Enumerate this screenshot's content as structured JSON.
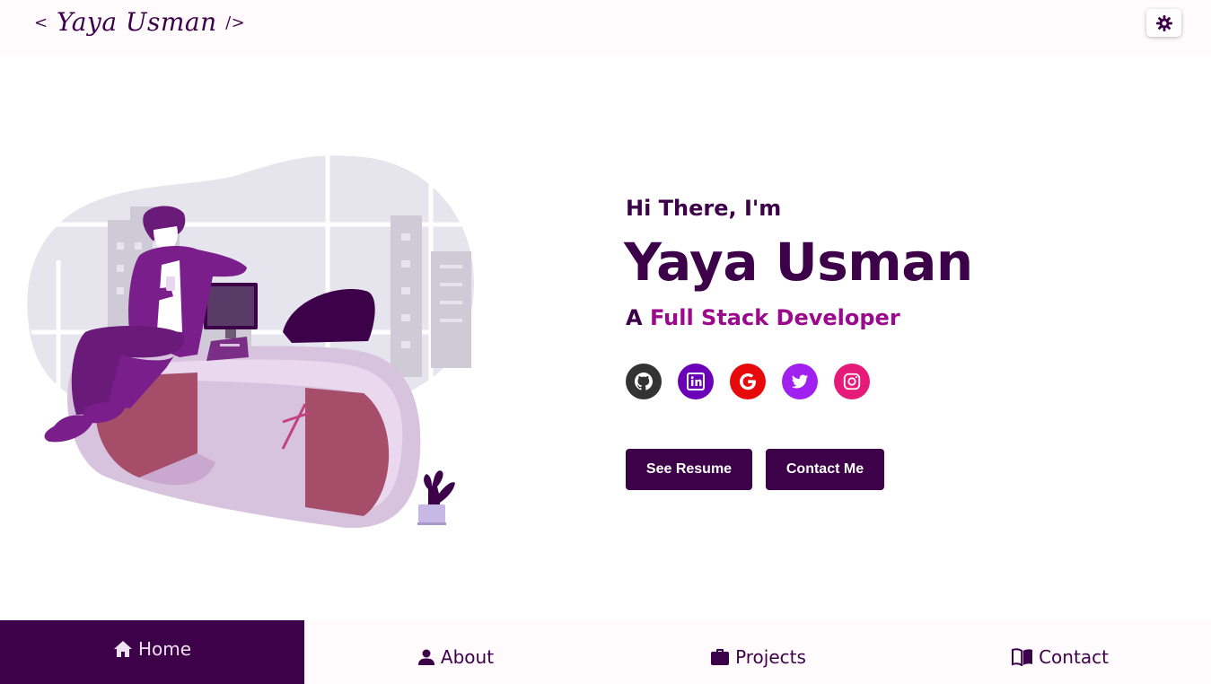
{
  "header": {
    "logo_open": "<",
    "logo_text": "Yaya Usman",
    "logo_close": "/>",
    "theme_toggle_icon": "sun-gear-icon"
  },
  "hero": {
    "greeting": "Hi There, I'm",
    "name": "Yaya Usman",
    "role_prefix": "A",
    "role_highlight": "Full Stack Developer",
    "socials": [
      {
        "icon": "github-icon",
        "color": "#333333"
      },
      {
        "icon": "linkedin-icon",
        "color": "#6a00b8"
      },
      {
        "icon": "google-icon",
        "color": "#e60a0a"
      },
      {
        "icon": "twitter-icon",
        "color": "#a020f0"
      },
      {
        "icon": "instagram-icon",
        "color": "#e61a78"
      }
    ],
    "resume_button": "See Resume",
    "contact_button": "Contact Me"
  },
  "nav": {
    "items": [
      {
        "label": "Home",
        "icon": "home-icon",
        "active": true
      },
      {
        "label": "About",
        "icon": "user-icon",
        "active": false
      },
      {
        "label": "Projects",
        "icon": "briefcase-icon",
        "active": false
      },
      {
        "label": "Contact",
        "icon": "book-icon",
        "active": false
      }
    ]
  },
  "colors": {
    "primary": "#3d0149",
    "accent": "#9a0a8c",
    "nav_bg": "#fffbfd"
  }
}
